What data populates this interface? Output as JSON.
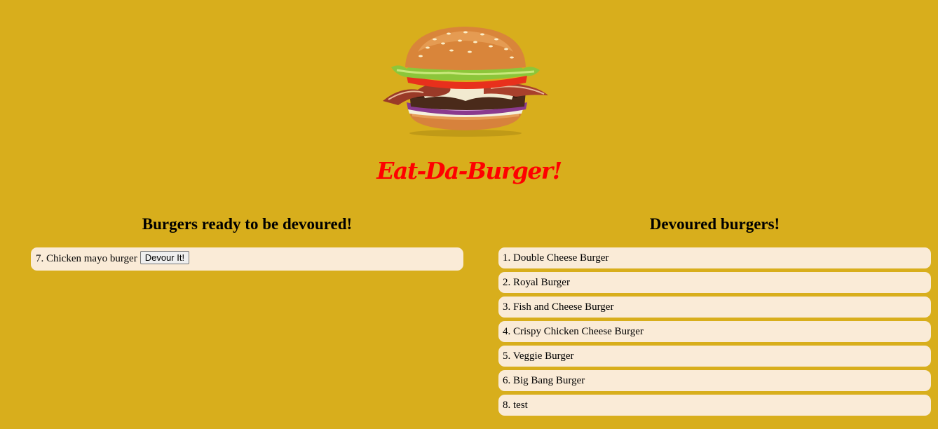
{
  "header": {
    "title": "Eat-Da-Burger!"
  },
  "ready": {
    "heading": "Burgers ready to be devoured!",
    "items": [
      {
        "label": "7. Chicken mayo burger",
        "button_label": "Devour It!"
      }
    ]
  },
  "devoured": {
    "heading": "Devoured burgers!",
    "items": [
      {
        "label": "1. Double Cheese Burger"
      },
      {
        "label": "2. Royal Burger"
      },
      {
        "label": "3. Fish and Cheese Burger"
      },
      {
        "label": "4. Crispy Chicken Cheese Burger"
      },
      {
        "label": "5. Veggie Burger"
      },
      {
        "label": "6. Big Bang Burger"
      },
      {
        "label": "8. test"
      }
    ]
  },
  "colors": {
    "background": "#d8ae1c",
    "title": "#ff0000",
    "item_background": "#faebd7"
  },
  "images": {
    "hero": "burger-image"
  }
}
